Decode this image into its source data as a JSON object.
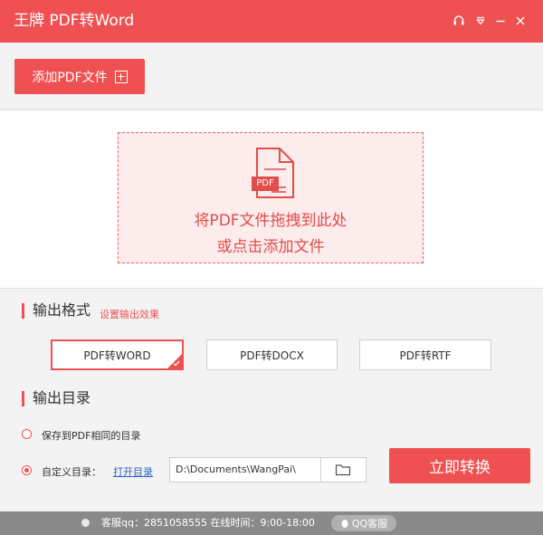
{
  "app": {
    "title": "王牌 PDF转Word",
    "accent_color": "#ef5152",
    "window_controls": [
      "headset-icon",
      "dropdown-icon",
      "minimize-icon",
      "close-icon"
    ]
  },
  "toolbar": {
    "add_pdf_label": "添加PDF文件"
  },
  "drop_zone": {
    "badge": "PDF",
    "line1": "将PDF文件拖拽到此处",
    "line2": "或点击添加文件"
  },
  "output_format": {
    "title": "输出格式",
    "effect_link": "设置输出效果",
    "options": [
      "PDF转WORD",
      "PDF转DOCX",
      "PDF转RTF"
    ],
    "selected": "PDF转WORD"
  },
  "output_dir": {
    "title": "输出目录",
    "option_same": "保存到PDF相同的目录",
    "option_custom": "自定义目录：",
    "selected": "自定义目录",
    "open_link": "打开目录",
    "path_value": "D:\\Documents\\WangPai\\"
  },
  "convert_label": "立即转换",
  "status": {
    "support_text": "客服qq：2851058555 在线时间：9:00-18:00",
    "qq_label": "QQ客服"
  }
}
